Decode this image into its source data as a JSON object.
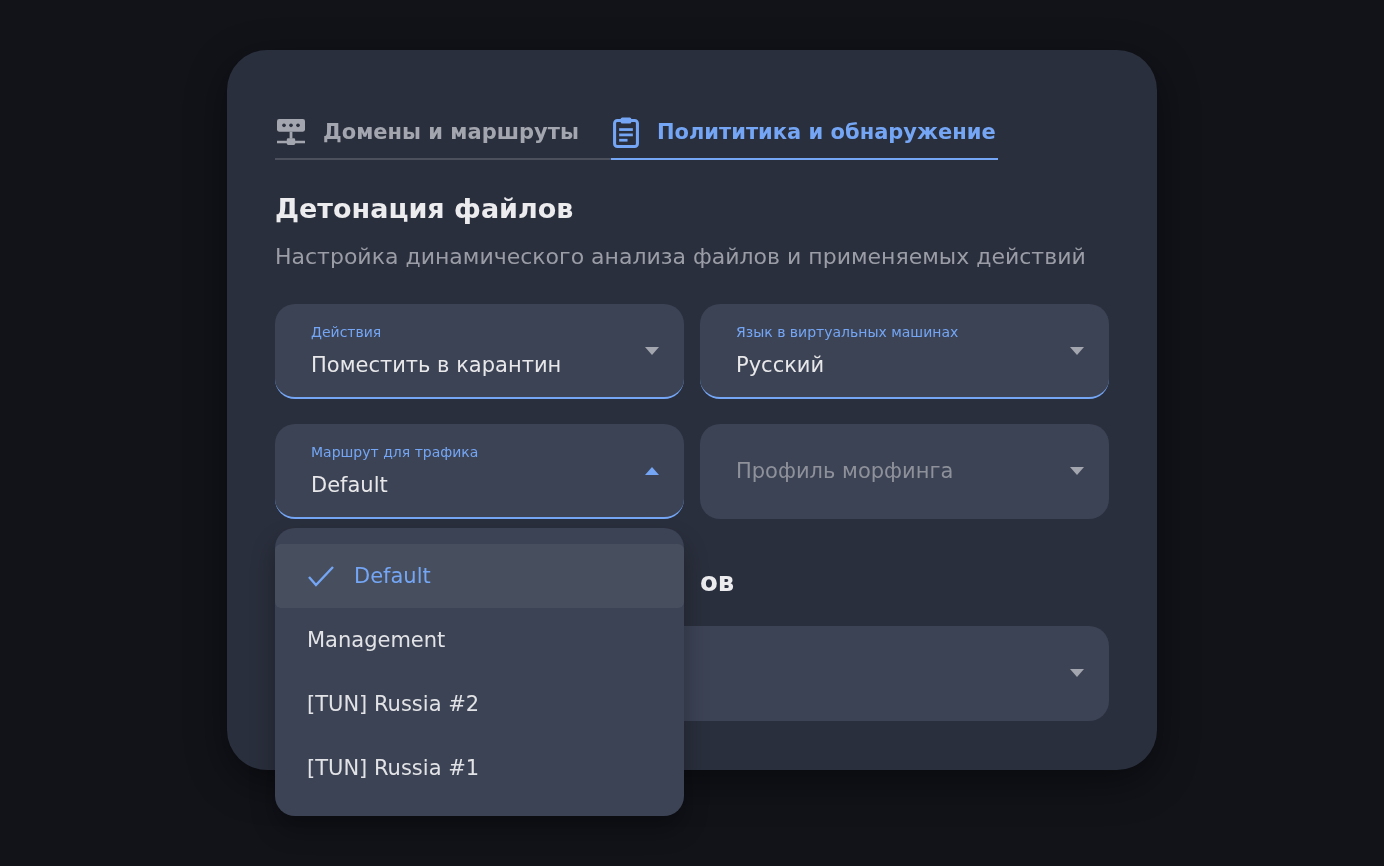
{
  "tabs": [
    {
      "label": "Домены и маршруты",
      "selected": false
    },
    {
      "label": "Полититика и обнаружение",
      "selected": true
    }
  ],
  "section": {
    "title": "Детонация файлов",
    "subtitle": "Настройка динамического анализа файлов и применяемых действий"
  },
  "fields": [
    {
      "label": "Действия",
      "value": "Поместить в карантин",
      "expanded": false
    },
    {
      "label": "Язык в виртуальных машинах",
      "value": "Русский",
      "expanded": false
    },
    {
      "label": "Маршрут для трафика",
      "value": "Default",
      "expanded": true,
      "options": [
        {
          "label": "Default",
          "selected": true
        },
        {
          "label": "Management",
          "selected": false
        },
        {
          "label": "[TUN] Russia #2",
          "selected": false
        },
        {
          "label": "[TUN] Russia #1",
          "selected": false
        }
      ]
    },
    {
      "placeholder": "Профиль морфинга",
      "expanded": false
    }
  ],
  "section_2": {
    "title": "ов",
    "fields": [
      {
        "expanded": false
      }
    ]
  }
}
